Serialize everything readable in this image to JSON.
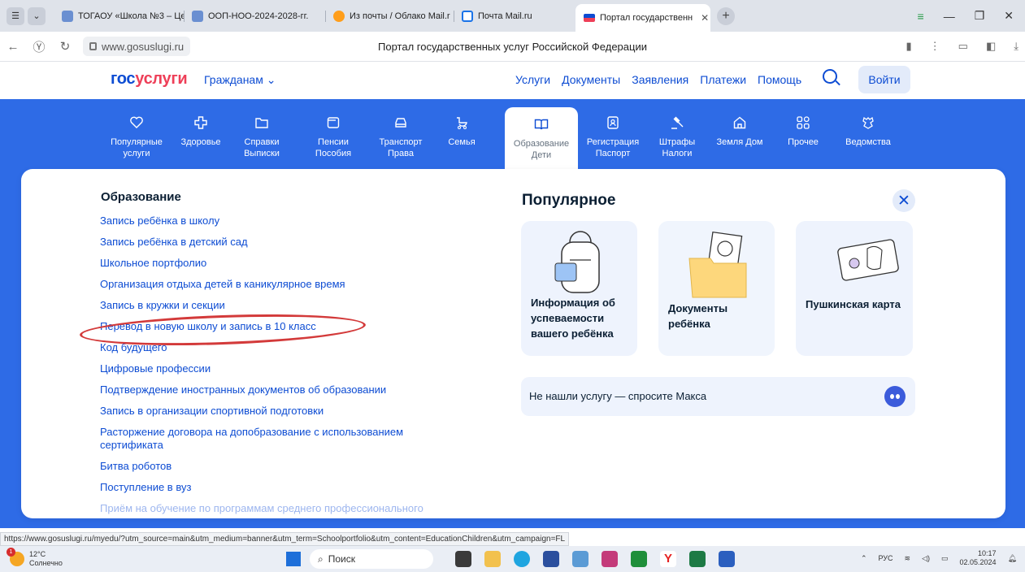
{
  "browser": {
    "tabs": [
      {
        "label": "ТОГАОУ «Школа №3 – Це",
        "icon": "school-favicon"
      },
      {
        "label": "ООП-НОО-2024-2028-гг.",
        "icon": "school-favicon"
      },
      {
        "label": "Из почты / Облако Mail.r",
        "icon": "cloud-favicon"
      },
      {
        "label": "Почта Mail.ru",
        "icon": "mail-favicon"
      },
      {
        "label": "Портал государственн",
        "icon": "gosuslugi-favicon",
        "active": true
      }
    ],
    "url": "www.gosuslugi.ru",
    "page_title": "Портал государственных услуг Российской Федерации"
  },
  "header": {
    "logo_part1": "гос",
    "logo_part2": "услуги",
    "audience": "Гражданам",
    "nav": [
      "Услуги",
      "Документы",
      "Заявления",
      "Платежи",
      "Помощь"
    ],
    "login": "Войти"
  },
  "categories": [
    {
      "l1": "Популярные",
      "l2": "услуги",
      "icon": "heart-icon"
    },
    {
      "l1": "Здоровье",
      "l2": "",
      "icon": "medical-cross-icon"
    },
    {
      "l1": "Справки",
      "l2": "Выписки",
      "icon": "folder-icon"
    },
    {
      "l1": "Пенсии",
      "l2": "Пособия",
      "icon": "wallet-icon"
    },
    {
      "l1": "Транспорт",
      "l2": "Права",
      "icon": "car-icon"
    },
    {
      "l1": "Семья",
      "l2": "",
      "icon": "stroller-icon"
    },
    {
      "l1": "Образование",
      "l2": "Дети",
      "icon": "book-icon",
      "active": true
    },
    {
      "l1": "Регистрация",
      "l2": "Паспорт",
      "icon": "passport-icon"
    },
    {
      "l1": "Штрафы",
      "l2": "Налоги",
      "icon": "gavel-icon"
    },
    {
      "l1": "Земля Дом",
      "l2": "",
      "icon": "house-icon"
    },
    {
      "l1": "Прочее",
      "l2": "",
      "icon": "grid-icon"
    },
    {
      "l1": "Ведомства",
      "l2": "",
      "icon": "emblem-icon"
    }
  ],
  "education": {
    "title": "Образование",
    "links": [
      "Запись ребёнка в школу",
      "Запись ребёнка в детский сад",
      "Школьное портфолио",
      "Организация отдыха детей в каникулярное время",
      "Запись в кружки и секции",
      "Перевод в новую школу и запись в 10 класс",
      "Код будущего",
      "Цифровые профессии",
      "Подтверждение иностранных документов об образовании",
      "Запись в организации спортивной подготовки",
      "Расторжение договора на допобразование с использованием сертификата",
      "Битва роботов",
      "Поступление в вуз",
      "Приём на обучение по программам среднего профессионального"
    ]
  },
  "popular": {
    "title": "Популярное",
    "cards": [
      {
        "label": "Информация об успеваемости вашего ребёнка",
        "icon": "backpack-icon"
      },
      {
        "label": "Документы ребёнка",
        "icon": "folder-photo-icon"
      },
      {
        "label": "Пушкинская карта",
        "icon": "pushkin-card-icon"
      }
    ],
    "ask_max": "Не нашли услугу — спросите Макса"
  },
  "status_url": "https://www.gosuslugi.ru/myedu/?utm_source=main&utm_medium=banner&utm_term=Schoolportfolio&utm_content=EducationChildren&utm_campaign=FL",
  "taskbar": {
    "temp": "12°C",
    "weather": "Солнечно",
    "search": "Поиск",
    "lang": "РУС",
    "time": "10:17",
    "date": "02.05.2024",
    "badge": "1"
  }
}
